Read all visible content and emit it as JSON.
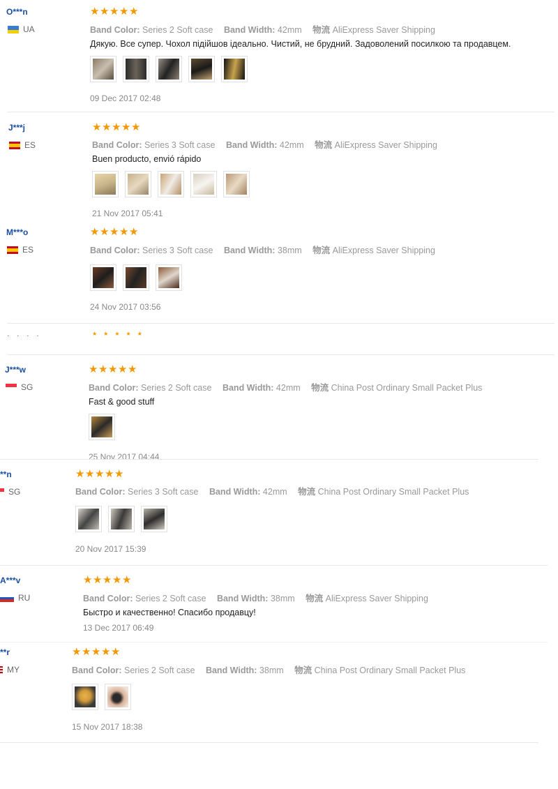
{
  "labels": {
    "band_color": "Band Color:",
    "band_width": "Band Width:",
    "logistics": "物流"
  },
  "reviews": [
    {
      "name": "O***n",
      "country": "UA",
      "rating": 5,
      "band_color": "Series 2 Soft case",
      "band_width": "42mm",
      "shipping": "AliExpress Saver Shipping",
      "text": "Дякую. Все супер. Чохол підійшов ідеально. Чистий, не брудний. Задоволений посилкою та продавцем.",
      "photos": 5,
      "date": "09 Dec 2017 02:48"
    },
    {
      "name": "J***j",
      "country": "ES",
      "rating": 5,
      "band_color": "Series 3 Soft case",
      "band_width": "42mm",
      "shipping": "AliExpress Saver Shipping",
      "text": "Buen producto, envió rápido",
      "photos": 5,
      "date": "21 Nov 2017 05:41"
    },
    {
      "name": "M***o",
      "country": "ES",
      "rating": 5,
      "band_color": "Series 3 Soft case",
      "band_width": "38mm",
      "shipping": "AliExpress Saver Shipping",
      "text": "",
      "photos": 3,
      "date": "24 Nov 2017 03:56"
    },
    {
      "name": "J***w",
      "country": "SG",
      "rating": 5,
      "band_color": "Series 2 Soft case",
      "band_width": "42mm",
      "shipping": "China Post Ordinary Small Packet Plus",
      "text": "Fast & good stuff",
      "photos": 1,
      "date": "25 Nov 2017 04:44"
    },
    {
      "name": "**n",
      "country": "SG",
      "rating": 5,
      "band_color": "Series 3 Soft case",
      "band_width": "42mm",
      "shipping": "China Post Ordinary Small Packet Plus",
      "text": "",
      "photos": 3,
      "date": "20 Nov 2017 15:39"
    },
    {
      "name": "A***v",
      "country": "RU",
      "rating": 5,
      "band_color": "Series 2 Soft case",
      "band_width": "38mm",
      "shipping": "AliExpress Saver Shipping",
      "text": "Быстро и качественно! Спасибо продавцу!",
      "photos": 0,
      "date": "13 Dec 2017 06:49"
    },
    {
      "name": "**r",
      "country": "MY",
      "rating": 5,
      "band_color": "Series 2 Soft case",
      "band_width": "38mm",
      "shipping": "China Post Ordinary Small Packet Plus",
      "text": "",
      "photos": 2,
      "date": "15 Nov 2017 18:38"
    }
  ],
  "colors": {
    "star": "#f39800",
    "name": "#1a4fa0"
  }
}
